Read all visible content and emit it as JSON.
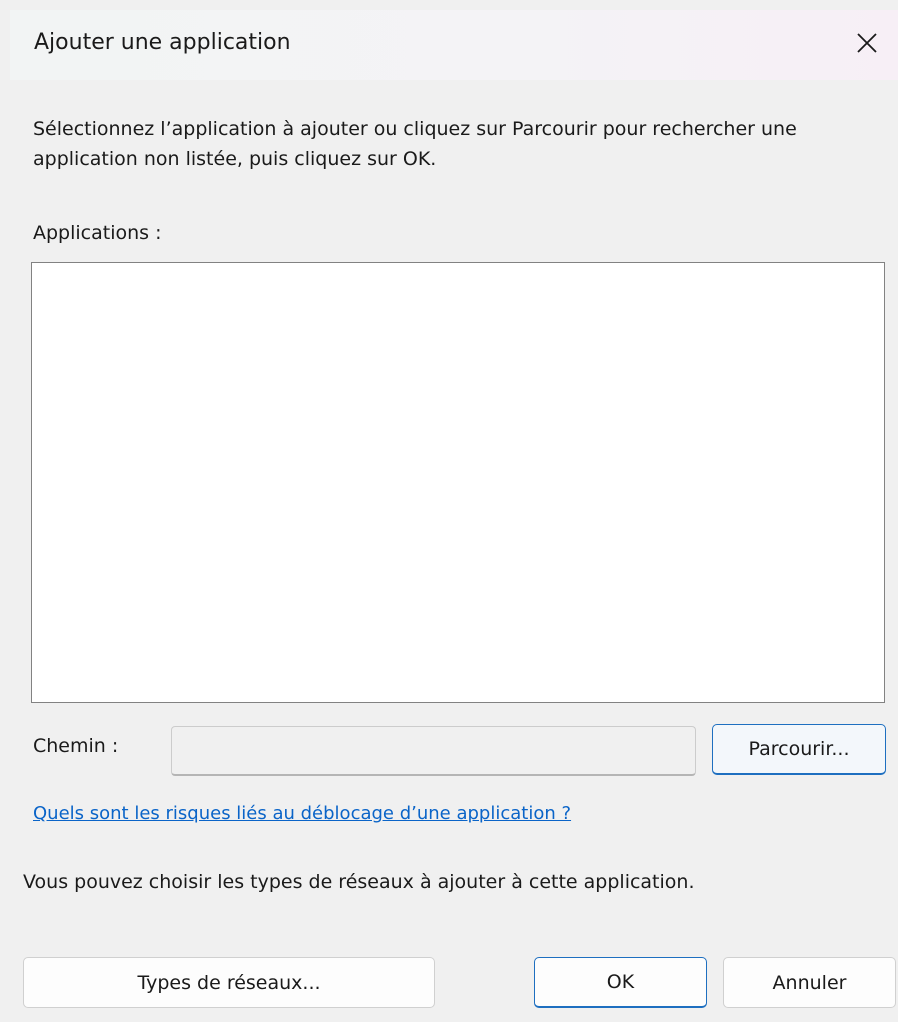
{
  "window": {
    "title": "Ajouter une application",
    "close_icon": "close-icon"
  },
  "intro": {
    "text": "Sélectionnez l’application à ajouter ou cliquez sur Parcourir pour rechercher une application non listée, puis cliquez sur OK."
  },
  "applications": {
    "label": "Applications :",
    "items": []
  },
  "path": {
    "label": "Chemin :",
    "value": "",
    "browse_label": "Parcourir..."
  },
  "risk_link": {
    "text": "Quels sont les risques liés au déblocage d’une application ?"
  },
  "network_info": {
    "text": "Vous pouvez choisir les types de réseaux à ajouter à cette application."
  },
  "buttons": {
    "network_types": "Types de réseaux...",
    "ok": "OK",
    "cancel": "Annuler"
  },
  "colors": {
    "accent": "#1e6fc0",
    "link": "#0a64c8",
    "background": "#f0f0f0"
  }
}
